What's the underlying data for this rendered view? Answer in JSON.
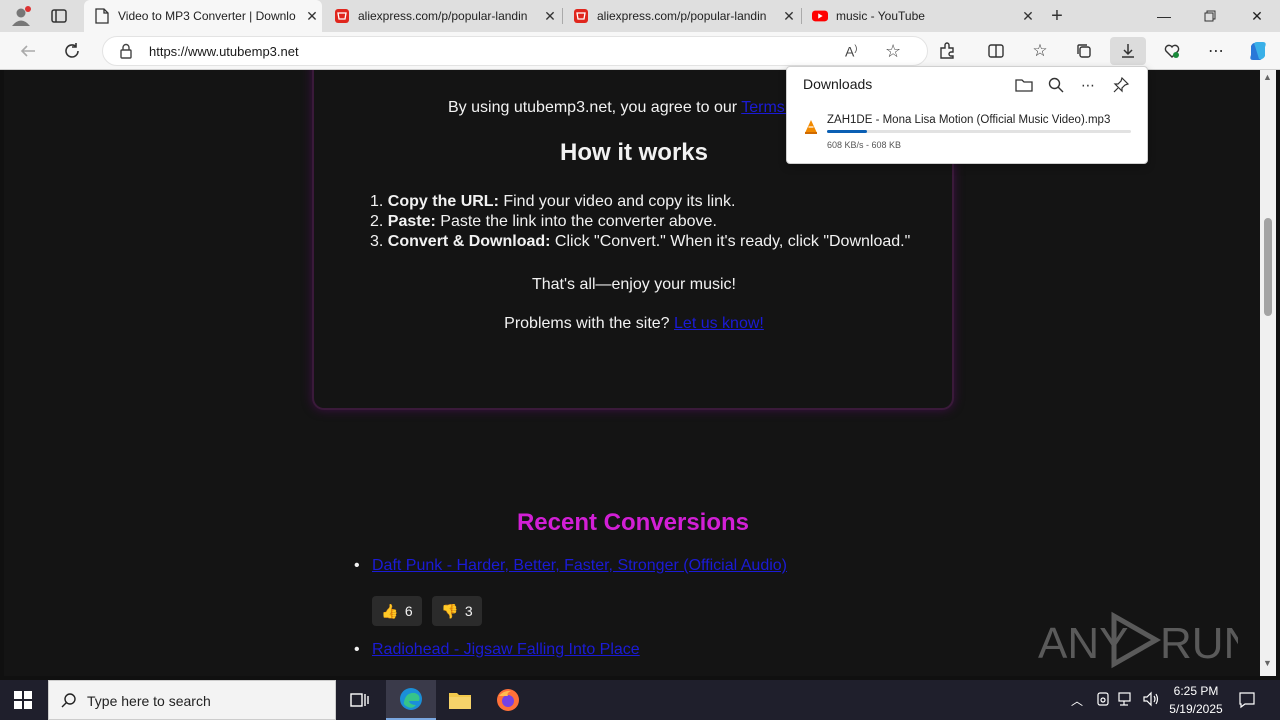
{
  "tabs": [
    {
      "title": "Video to MP3 Converter | Downlo",
      "active": true
    },
    {
      "title": "aliexpress.com/p/popular-landin",
      "active": false
    },
    {
      "title": "aliexpress.com/p/popular-landin",
      "active": false
    },
    {
      "title": "music - YouTube",
      "active": false
    }
  ],
  "address": {
    "url": "https://www.utubemp3.net"
  },
  "page": {
    "agree_prefix": "By using utubemp3.net, you agree to our",
    "agree_link": "Terms of",
    "how_title": "How it works",
    "steps": [
      {
        "bold": "Copy the URL:",
        "text": " Find your video and copy its link."
      },
      {
        "bold": "Paste:",
        "text": " Paste the link into the converter above."
      },
      {
        "bold": "Convert & Download:",
        "text": " Click \"Convert.\" When it's ready, click \"Download.\""
      }
    ],
    "enjoy": "That's all—enjoy your music!",
    "problems_prefix": "Problems with the site?",
    "problems_link": "Let us know!",
    "recent_title": "Recent Conversions",
    "recent": [
      {
        "title": "Daft Punk - Harder, Better, Faster, Stronger (Official Audio)",
        "likes": "6",
        "dislikes": "3"
      },
      {
        "title": "Radiohead - Jigsaw Falling Into Place"
      }
    ]
  },
  "downloads": {
    "title": "Downloads",
    "file": "ZAH1DE - Mona Lisa Motion (Official Music Video).mp3",
    "status": "608 KB/s - 608 KB",
    "progress": 0.13
  },
  "taskbar": {
    "search_placeholder": "Type here to search",
    "time": "6:25 PM",
    "date": "5/19/2025"
  },
  "watermark": "ANY RUN",
  "colors": {
    "accent_magenta": "#d21fd6",
    "link_blue": "#1b1bd6",
    "download_blue": "#0a5fb4"
  }
}
